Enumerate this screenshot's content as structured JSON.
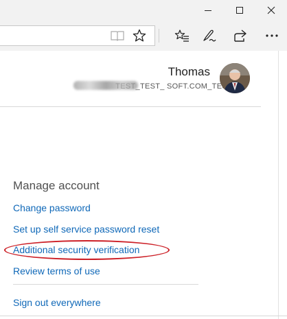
{
  "window": {
    "controls": {
      "minimize": "minimize-icon",
      "maximize": "maximize-icon",
      "close": "close-icon"
    }
  },
  "toolbar": {
    "address_value": "",
    "icons": [
      "reading-view-icon",
      "favorite-star-icon",
      "favorites-hub-icon",
      "web-note-icon",
      "share-icon",
      "more-icon"
    ]
  },
  "user": {
    "name": "Thomas",
    "email": "TEST_TEST_                   SOFT.COM_TEST"
  },
  "manage": {
    "title": "Manage account",
    "links": {
      "change_password": "Change password",
      "sspr": "Set up self service password reset",
      "additional_security": "Additional security verification",
      "terms": "Review terms of use",
      "signout": "Sign out everywhere"
    }
  },
  "colors": {
    "link": "#0f68b8",
    "annotation": "#cc1f26",
    "chrome": "#f2f2f2"
  }
}
